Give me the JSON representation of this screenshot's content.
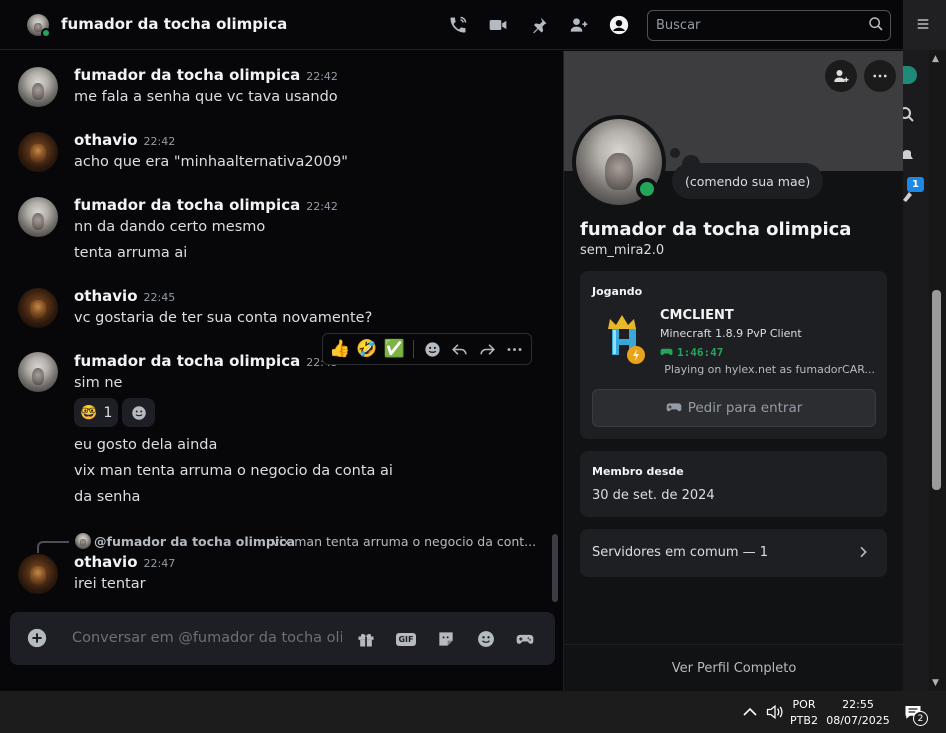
{
  "header": {
    "title": "fumador da tocha olimpica",
    "search_placeholder": "Buscar"
  },
  "messages": [
    {
      "author": "fumador da tocha olimpica",
      "time": "22:42",
      "lines": [
        "me fala a senha que vc tava usando"
      ]
    },
    {
      "author": "othavio",
      "time": "22:42",
      "lines": [
        "acho que era \"minhaalternativa2009\""
      ]
    },
    {
      "author": "fumador da tocha olimpica",
      "time": "22:42",
      "lines": [
        "nn da dando certo mesmo",
        "tenta arruma ai"
      ]
    },
    {
      "author": "othavio",
      "time": "22:45",
      "lines": [
        "vc gostaria de ter sua conta novamente?"
      ]
    },
    {
      "author": "fumador da tocha olimpica",
      "time": "22:45",
      "lines": [
        "sim ne",
        "eu gosto dela ainda",
        "vix man tenta arruma o negocio da conta ai",
        "da senha"
      ]
    },
    {
      "author": "othavio",
      "time": "22:47",
      "lines": [
        "irei tentar"
      ]
    }
  ],
  "reactions": [
    {
      "emoji": "🤓",
      "count": "1"
    }
  ],
  "hover_bar": {
    "quick_reactions": [
      "👍",
      "🤣",
      "✅"
    ]
  },
  "reply": {
    "author": "@fumador da tocha olimpica",
    "snippet": "vix man tenta arruma o negocio da cont..."
  },
  "composer": {
    "placeholder": "Conversar em @fumador da tocha oli..."
  },
  "profile": {
    "custom_status": "(comendo sua mae)",
    "display_name": "fumador da tocha olimpica",
    "username": "sem_mira2.0",
    "activity_label": "Jogando",
    "game_name": "CMCLIENT",
    "game_detail": "Minecraft 1.8.9 PvP Client",
    "game_timer": "1:46:47",
    "game_state": "Playing on hylex.net as fumadorCAR...",
    "join_button": "Pedir para entrar",
    "member_since_label": "Membro desde",
    "member_since": "30 de set. de 2024",
    "mutual_servers": "Servidores em comum — 1",
    "view_full_profile": "Ver Perfil Completo"
  },
  "right_strip": {
    "badge_count": "1"
  },
  "taskbar": {
    "lang_line1": "POR",
    "lang_line2": "PTB2",
    "time": "22:55",
    "date": "08/07/2025",
    "notification_count": "2"
  },
  "colors": {
    "online": "#23a55a",
    "timer_green": "#23a55a",
    "badge_blue": "#1e88e5"
  }
}
